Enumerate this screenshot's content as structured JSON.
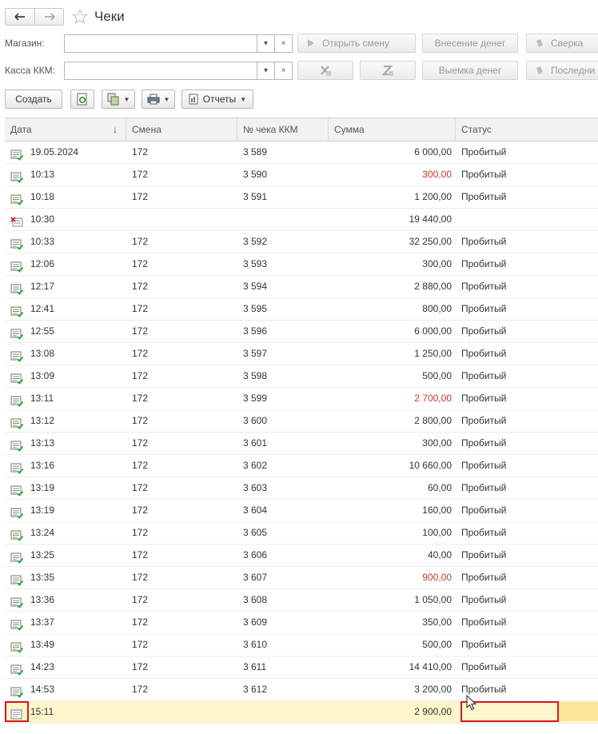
{
  "window": {
    "title": "Чеки"
  },
  "filters": {
    "shop_label": "Магазин:",
    "kkm_label": "Касса ККМ:",
    "shop_value": "",
    "kkm_value": ""
  },
  "actions": {
    "open_shift": "Открыть смену",
    "cash_in": "Внесение денег",
    "reconcile": "Сверка",
    "cash_out": "Выемка денег",
    "last": "Последни"
  },
  "toolbar": {
    "create": "Создать",
    "reports": "Отчеты"
  },
  "table": {
    "columns": [
      "Дата",
      "Смена",
      "№ чека ККМ",
      "Сумма",
      "Статус"
    ],
    "rows": [
      {
        "date": "19.05.2024",
        "shift": "172",
        "check": "3 589",
        "sum": "6 000,00",
        "status": "Пробитый",
        "icon": "check-ok-icon",
        "neg": false
      },
      {
        "date": "10:13",
        "shift": "172",
        "check": "3 590",
        "sum": "300,00",
        "status": "Пробитый",
        "icon": "check-ok-icon",
        "neg": true
      },
      {
        "date": "10:18",
        "shift": "172",
        "check": "3 591",
        "sum": "1 200,00",
        "status": "Пробитый",
        "icon": "check-ok-icon",
        "neg": false
      },
      {
        "date": "10:30",
        "shift": "",
        "check": "",
        "sum": "19 440,00",
        "status": "",
        "icon": "check-deleted-icon",
        "neg": false
      },
      {
        "date": "10:33",
        "shift": "172",
        "check": "3 592",
        "sum": "32 250,00",
        "status": "Пробитый",
        "icon": "check-ok-icon",
        "neg": false
      },
      {
        "date": "12:06",
        "shift": "172",
        "check": "3 593",
        "sum": "300,00",
        "status": "Пробитый",
        "icon": "check-ok-icon",
        "neg": false
      },
      {
        "date": "12:17",
        "shift": "172",
        "check": "3 594",
        "sum": "2 880,00",
        "status": "Пробитый",
        "icon": "check-ok-icon",
        "neg": false
      },
      {
        "date": "12:41",
        "shift": "172",
        "check": "3 595",
        "sum": "800,00",
        "status": "Пробитый",
        "icon": "check-ok-icon",
        "neg": false
      },
      {
        "date": "12:55",
        "shift": "172",
        "check": "3 596",
        "sum": "6 000,00",
        "status": "Пробитый",
        "icon": "check-ok-icon",
        "neg": false
      },
      {
        "date": "13:08",
        "shift": "172",
        "check": "3 597",
        "sum": "1 250,00",
        "status": "Пробитый",
        "icon": "check-ok-icon",
        "neg": false
      },
      {
        "date": "13:09",
        "shift": "172",
        "check": "3 598",
        "sum": "500,00",
        "status": "Пробитый",
        "icon": "check-ok-icon",
        "neg": false
      },
      {
        "date": "13:11",
        "shift": "172",
        "check": "3 599",
        "sum": "2 700,00",
        "status": "Пробитый",
        "icon": "check-ok-icon",
        "neg": true
      },
      {
        "date": "13:12",
        "shift": "172",
        "check": "3 600",
        "sum": "2 800,00",
        "status": "Пробитый",
        "icon": "check-ok-icon",
        "neg": false
      },
      {
        "date": "13:13",
        "shift": "172",
        "check": "3 601",
        "sum": "300,00",
        "status": "Пробитый",
        "icon": "check-ok-icon",
        "neg": false
      },
      {
        "date": "13:16",
        "shift": "172",
        "check": "3 602",
        "sum": "10 660,00",
        "status": "Пробитый",
        "icon": "check-ok-icon",
        "neg": false
      },
      {
        "date": "13:19",
        "shift": "172",
        "check": "3 603",
        "sum": "60,00",
        "status": "Пробитый",
        "icon": "check-ok-icon",
        "neg": false
      },
      {
        "date": "13:19",
        "shift": "172",
        "check": "3 604",
        "sum": "160,00",
        "status": "Пробитый",
        "icon": "check-ok-icon",
        "neg": false
      },
      {
        "date": "13:24",
        "shift": "172",
        "check": "3 605",
        "sum": "100,00",
        "status": "Пробитый",
        "icon": "check-ok-icon",
        "neg": false
      },
      {
        "date": "13:25",
        "shift": "172",
        "check": "3 606",
        "sum": "40,00",
        "status": "Пробитый",
        "icon": "check-ok-icon",
        "neg": false
      },
      {
        "date": "13:35",
        "shift": "172",
        "check": "3 607",
        "sum": "900,00",
        "status": "Пробитый",
        "icon": "check-ok-icon",
        "neg": true
      },
      {
        "date": "13:36",
        "shift": "172",
        "check": "3 608",
        "sum": "1 050,00",
        "status": "Пробитый",
        "icon": "check-ok-icon",
        "neg": false
      },
      {
        "date": "13:37",
        "shift": "172",
        "check": "3 609",
        "sum": "350,00",
        "status": "Пробитый",
        "icon": "check-ok-icon",
        "neg": false
      },
      {
        "date": "13:49",
        "shift": "172",
        "check": "3 610",
        "sum": "500,00",
        "status": "Пробитый",
        "icon": "check-ok-icon",
        "neg": false
      },
      {
        "date": "14:23",
        "shift": "172",
        "check": "3 611",
        "sum": "14 410,00",
        "status": "Пробитый",
        "icon": "check-ok-icon",
        "neg": false
      },
      {
        "date": "14:53",
        "shift": "172",
        "check": "3 612",
        "sum": "3 200,00",
        "status": "Пробитый",
        "icon": "check-ok-icon",
        "neg": false
      },
      {
        "date": "15:11",
        "shift": "",
        "check": "",
        "sum": "2 900,00",
        "status": "",
        "icon": "check-draft-icon",
        "neg": false,
        "selected": true
      }
    ]
  },
  "colors": {
    "negative": "#c0392b",
    "selected_row": "#fdf6cc",
    "highlight_box": "#d9171e"
  }
}
